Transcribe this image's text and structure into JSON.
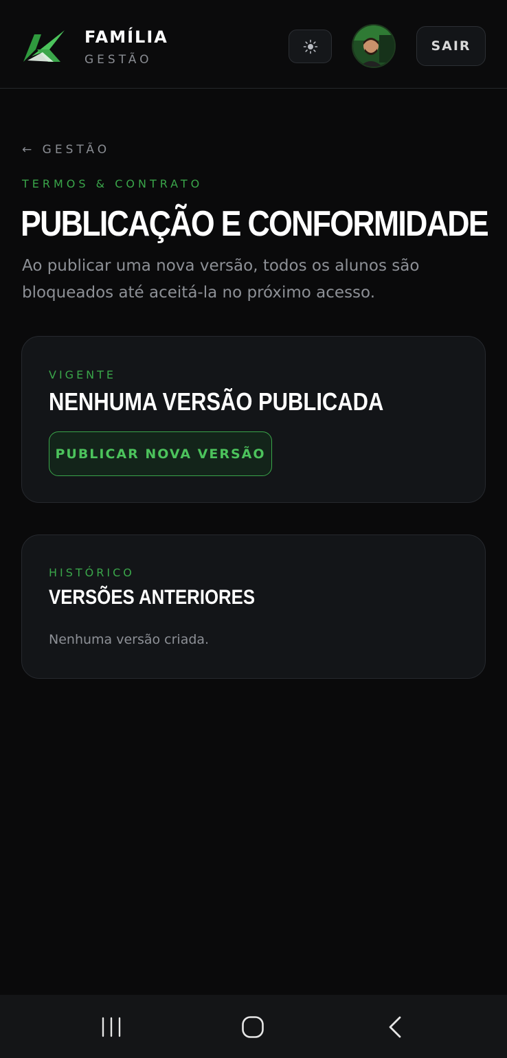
{
  "header": {
    "brand_title": "FAMÍLIA",
    "brand_subtitle": "GESTÃO",
    "theme_icon": "sun-icon",
    "logout_label": "SAIR"
  },
  "nav": {
    "back_label": "← GESTÃO"
  },
  "page": {
    "eyebrow": "TERMOS & CONTRATO",
    "title": "PUBLICAÇÃO E CONFORMIDADE",
    "description": "Ao publicar uma nova versão, todos os alunos são bloqueados até aceitá-la no próximo acesso."
  },
  "current_card": {
    "eyebrow": "VIGENTE",
    "title": "NENHUMA VERSÃO PUBLICADA",
    "publish_button": "PUBLICAR NOVA VERSÃO"
  },
  "history_card": {
    "eyebrow": "HISTÓRICO",
    "title": "VERSÕES ANTERIORES",
    "empty_text": "Nenhuma versão criada."
  },
  "colors": {
    "accent": "#3aa64a",
    "background": "#0a0a0b",
    "card": "#131518"
  },
  "system_nav": {
    "icons": [
      "recent-apps-icon",
      "home-icon",
      "back-icon"
    ]
  }
}
